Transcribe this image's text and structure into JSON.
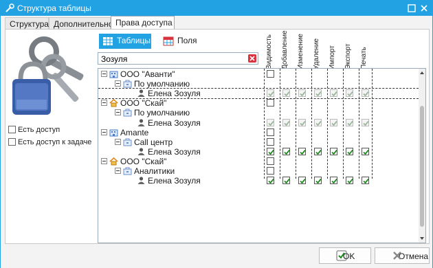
{
  "window": {
    "title": "Структура таблицы"
  },
  "tabs": [
    {
      "label": "Структура"
    },
    {
      "label": "Дополнительно"
    },
    {
      "label": "Права доступа"
    }
  ],
  "left": {
    "has_access": "Есть доступ",
    "has_task_access": "Есть доступ к задаче"
  },
  "segments": {
    "tables": "Таблицы",
    "fields": "Поля"
  },
  "search": {
    "value": "Зозуля"
  },
  "columns": [
    "Видимость",
    "Добавление",
    "Изменение",
    "Удаление",
    "Импорт",
    "Экспорт",
    "Печать"
  ],
  "tree": [
    {
      "label": "ООО \"Аванти\"",
      "level": 0,
      "type": "org",
      "ctrl": "minus",
      "checks": "one-empty"
    },
    {
      "label": "По умолчанию",
      "level": 1,
      "type": "group",
      "ctrl": "minus",
      "checks": "none"
    },
    {
      "label": "Елена Зозуля",
      "level": 2,
      "type": "user",
      "ctrl": "none",
      "checks": "all-dim"
    },
    {
      "label": "ООО \"Скай\"",
      "level": 0,
      "type": "home",
      "ctrl": "minus",
      "checks": "one-empty"
    },
    {
      "label": "По умолчанию",
      "level": 1,
      "type": "group",
      "ctrl": "minus",
      "checks": "none"
    },
    {
      "label": "Елена Зозуля",
      "level": 2,
      "type": "user",
      "ctrl": "none",
      "checks": "all-dim"
    },
    {
      "label": "Amante",
      "level": 0,
      "type": "org",
      "ctrl": "minus",
      "checks": "one-empty"
    },
    {
      "label": "Call центр",
      "level": 1,
      "type": "group",
      "ctrl": "minus",
      "checks": "one-empty"
    },
    {
      "label": "Елена Зозуля",
      "level": 2,
      "type": "user",
      "ctrl": "none",
      "checks": "all"
    },
    {
      "label": "ООО \"Скай\"",
      "level": 0,
      "type": "home",
      "ctrl": "minus",
      "checks": "one-empty"
    },
    {
      "label": "Аналитики",
      "level": 1,
      "type": "group",
      "ctrl": "minus",
      "checks": "one-empty"
    },
    {
      "label": "Елена Зозуля",
      "level": 2,
      "type": "user",
      "ctrl": "none",
      "checks": "all"
    }
  ],
  "buttons": {
    "ok": "OK",
    "cancel": "Отмена"
  },
  "colors": {
    "accent": "#22a2e3",
    "check": "#1d8a1d",
    "close_red": "#d9333f"
  },
  "icons": {
    "title": "settings-icon",
    "maximize": "maximize-icon",
    "close": "close-icon",
    "tables": "table-icon",
    "fields": "fields-table-icon",
    "clear": "clear-icon",
    "keys": "keys-lock-icon",
    "ok": "check-icon",
    "cancel": "cancel-icon"
  }
}
